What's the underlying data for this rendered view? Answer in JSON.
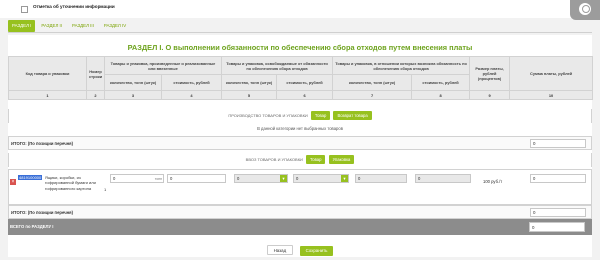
{
  "header": {
    "report_title": "Отметка об уточнении информации"
  },
  "tabs": [
    {
      "label": "РАЗДЕЛ I",
      "active": true
    },
    {
      "label": "РАЗДЕЛ II",
      "active": false
    },
    {
      "label": "РАЗДЕЛ III",
      "active": false
    },
    {
      "label": "РАЗДЕЛ IV",
      "active": false
    }
  ],
  "section": {
    "title": "РАЗДЕЛ I. О выполнении обязанности по обеспечению сбора отходов путем внесения платы"
  },
  "table": {
    "headers": {
      "code": "Код товара и упаковки",
      "row_no": "Номер строки",
      "produced": "Товары и упаковка, произведенные и реализованные или ввезенные",
      "exempt": "Товары и упаковка, освобождаемые от обязанности по обеспечению сбора отходов",
      "obligated": "Товары и упаковка, в отношении которых возникла обязанность по обеспечению сбора отходов",
      "rate": "Размер платы, рублей (процентов)",
      "sum": "Сумма платы, рублей",
      "qty": "количество, тонн (штук)",
      "cost": "стоимость, рублей"
    },
    "column_numbers": [
      "1",
      "2",
      "3",
      "4",
      "5",
      "6",
      "7",
      "8",
      "9",
      "10"
    ]
  },
  "production": {
    "label": "ПРОИЗВОДСТВО ТОВАРОВ И УПАКОВКИ",
    "btn_goods": "Товар",
    "btn_return": "Возврат товара",
    "empty_note": "В данной категории нет выбранных товаров",
    "itog_label": "ИТОГО: (По позиции перечня)",
    "itog_value": "0"
  },
  "import": {
    "label": "ВВОЗ ТОВАРОВ И УПАКОВКИ",
    "btn_goods": "Товар",
    "btn_pack": "Упаковка",
    "row": {
      "code": "4819100000",
      "description": "Ящики, коробки, из гофрированной бумаги или гофрированного картона",
      "row_no": "1",
      "qty_value": "0",
      "qty_unit": "тонн",
      "cost_value": "0",
      "exempt_qty": "0",
      "exempt_cost": "0",
      "oblig_qty": "0",
      "oblig_cost": "0",
      "rate": "100 руб./т",
      "sum": "0"
    },
    "itog_label": "ИТОГО: (По позиции перечня)",
    "itog_value": "0"
  },
  "total": {
    "label": "ВСЕГО по РАЗДЕЛУ I",
    "value": "0"
  },
  "buttons": {
    "back": "Назад",
    "save": "Сохранить"
  },
  "colors": {
    "accent": "#97c11f",
    "title": "#6ea31e",
    "total_bar": "#8c8c8c",
    "delete": "#d9534f"
  }
}
